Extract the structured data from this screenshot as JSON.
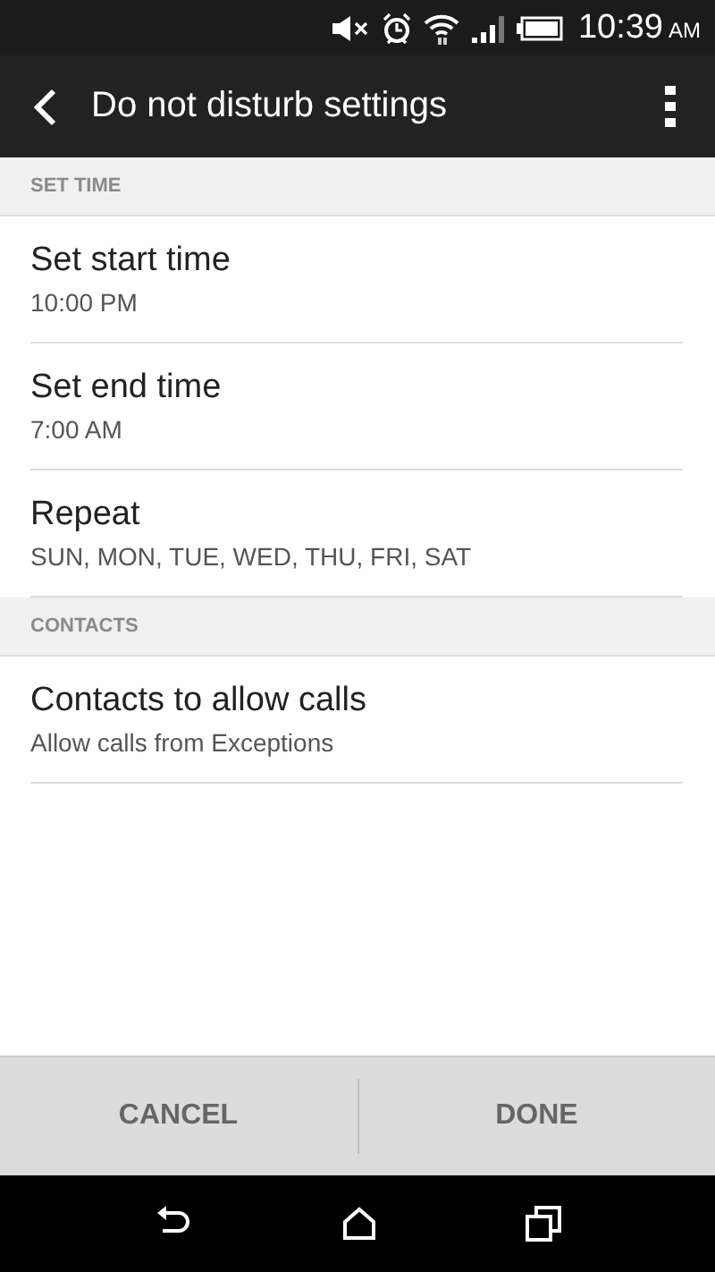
{
  "status_bar": {
    "time": "10:39",
    "meridiem": "AM"
  },
  "app_bar": {
    "title": "Do not disturb settings"
  },
  "sections": [
    {
      "header": "SET TIME",
      "items": [
        {
          "title": "Set start time",
          "subtitle": "10:00 PM"
        },
        {
          "title": "Set end time",
          "subtitle": "7:00 AM"
        },
        {
          "title": "Repeat",
          "subtitle": "SUN, MON, TUE, WED, THU, FRI, SAT"
        }
      ]
    },
    {
      "header": "CONTACTS",
      "items": [
        {
          "title": "Contacts to allow calls",
          "subtitle": "Allow calls from Exceptions"
        }
      ]
    }
  ],
  "buttons": [
    "CANCEL",
    "DONE"
  ]
}
